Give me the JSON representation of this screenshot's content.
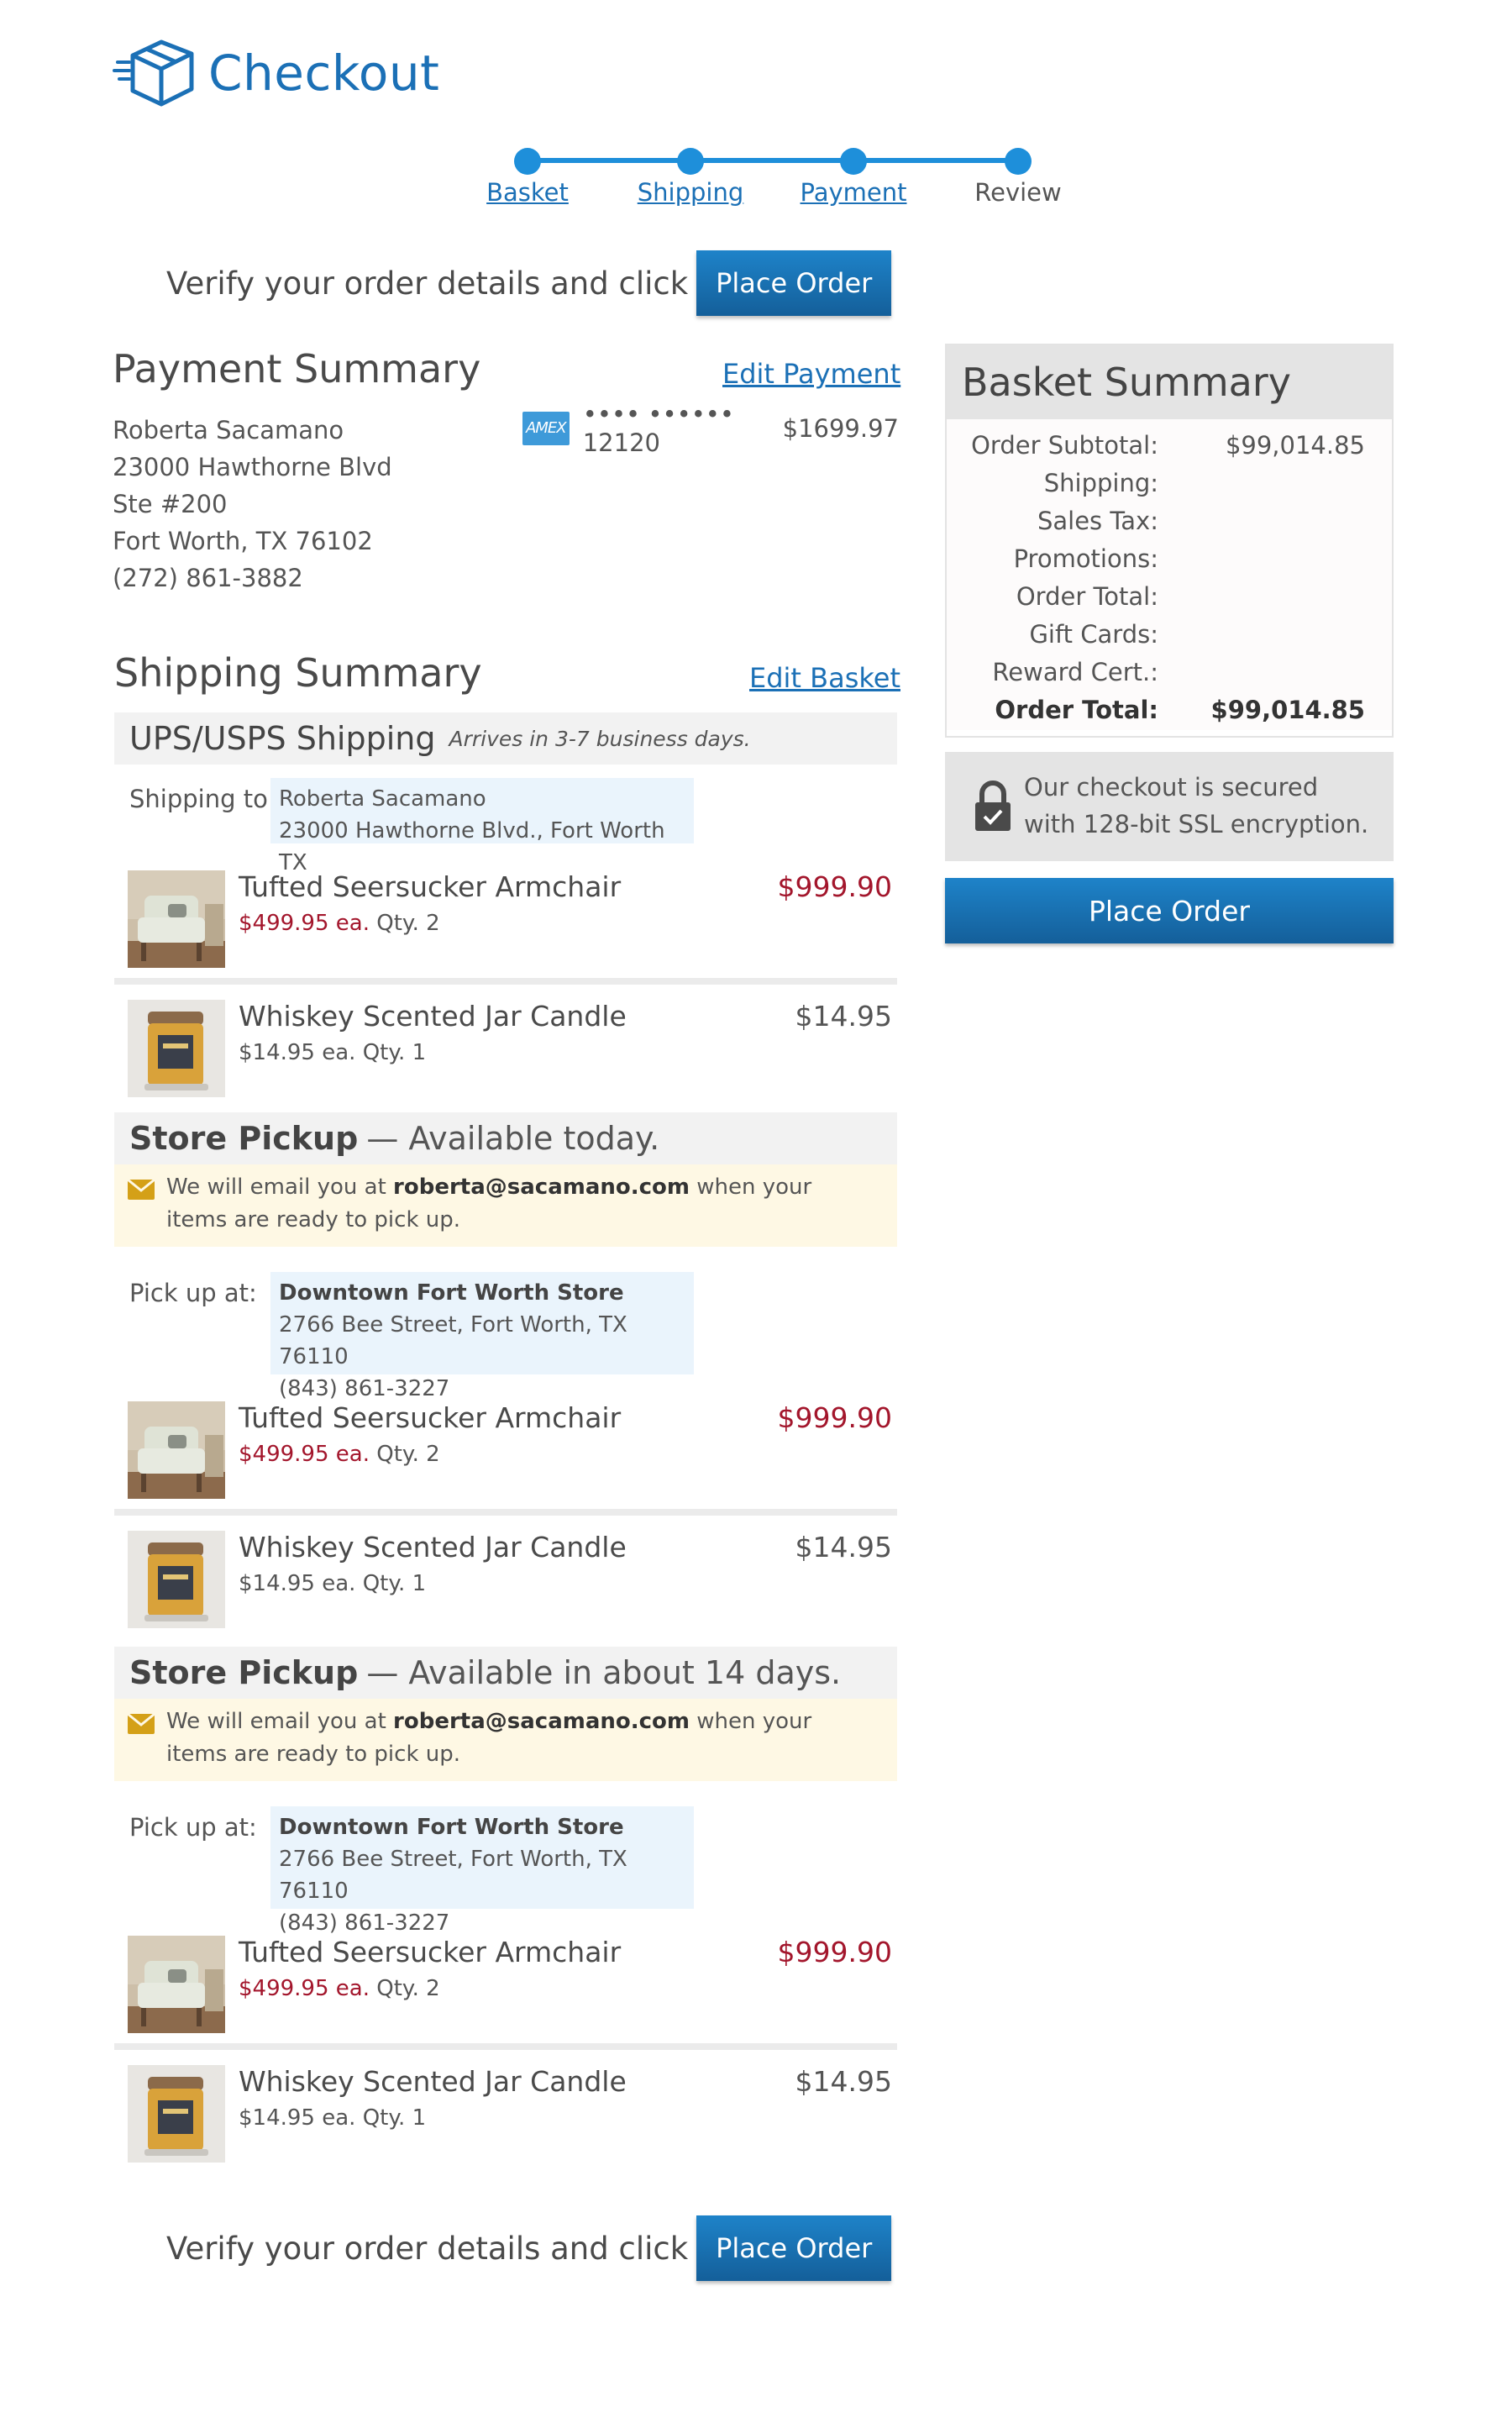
{
  "header": {
    "title": "Checkout",
    "logo_icon": "shipping-box-icon"
  },
  "steps": [
    {
      "label": "Basket",
      "state": "done"
    },
    {
      "label": "Shipping",
      "state": "done"
    },
    {
      "label": "Payment",
      "state": "done"
    },
    {
      "label": "Review",
      "state": "current"
    }
  ],
  "verify": {
    "text": "Verify your order details and click",
    "button": "Place Order"
  },
  "payment": {
    "title": "Payment Summary",
    "edit_label": "Edit Payment",
    "address": [
      "Roberta Sacamano",
      "23000 Hawthorne Blvd",
      "Ste #200",
      "Fort Worth, TX 76102",
      "(272) 861-3882"
    ],
    "card_brand": "AMEX",
    "card_masked": "•••• •••••• 12120",
    "amount": "$1699.97"
  },
  "shipping": {
    "title": "Shipping Summary",
    "edit_label": "Edit Basket",
    "method": "UPS/USPS Shipping",
    "method_note": "Arrives in 3-7 business days.",
    "ship_to_label": "Shipping to:",
    "ship_to": [
      "Roberta Sacamano",
      "23000 Hawthorne Blvd., Fort Worth TX"
    ],
    "items": [
      {
        "name": "Tufted Seersucker Armchair",
        "each": "$499.95 ea.",
        "qty": "Qty. 2",
        "total": "$999.90"
      },
      {
        "name": "Whiskey Scented Jar Candle",
        "each": "$14.95 ea.",
        "qty": "Qty. 1",
        "total": "$14.95"
      }
    ]
  },
  "pickups": [
    {
      "title": "Store Pickup",
      "availability": "— Available today.",
      "notice_pre": "We will email you at ",
      "notice_email": "roberta@sacamano.com",
      "notice_post": " when your items are ready to pick up.",
      "pickup_label": "Pick up at:",
      "store": [
        "Downtown Fort Worth Store",
        "2766 Bee Street, Fort Worth, TX 76110",
        "(843) 861-3227"
      ],
      "items": [
        {
          "name": "Tufted Seersucker Armchair",
          "each": "$499.95 ea.",
          "qty": "Qty. 2",
          "total": "$999.90"
        },
        {
          "name": "Whiskey Scented Jar Candle",
          "each": "$14.95 ea.",
          "qty": "Qty. 1",
          "total": "$14.95"
        }
      ]
    },
    {
      "title": "Store Pickup",
      "availability": "— Available in about 14 days.",
      "notice_pre": "We will email you at ",
      "notice_email": "roberta@sacamano.com",
      "notice_post": " when your items are ready to pick up.",
      "pickup_label": "Pick up at:",
      "store": [
        "Downtown Fort Worth Store",
        "2766 Bee Street, Fort Worth, TX 76110",
        "(843) 861-3227"
      ],
      "items": [
        {
          "name": "Tufted Seersucker Armchair",
          "each": "$499.95 ea.",
          "qty": "Qty. 2",
          "total": "$999.90"
        },
        {
          "name": "Whiskey Scented Jar Candle",
          "each": "$14.95 ea.",
          "qty": "Qty. 1",
          "total": "$14.95"
        }
      ]
    }
  ],
  "basket": {
    "title": "Basket Summary",
    "rows": [
      {
        "label": "Order Subtotal:",
        "value": "$99,014.85"
      },
      {
        "label": "Shipping:",
        "value": ""
      },
      {
        "label": "Sales Tax:",
        "value": ""
      },
      {
        "label": "Promotions:",
        "value": ""
      },
      {
        "label": "Order Total:",
        "value": ""
      },
      {
        "label": "Gift Cards:",
        "value": ""
      },
      {
        "label": "Reward Cert.:",
        "value": ""
      },
      {
        "label": "Order Total:",
        "value": "$99,014.85"
      }
    ]
  },
  "secure": {
    "text": "Our checkout is secured with 128-bit SSL encryption.",
    "icon": "lock-icon"
  },
  "colors": {
    "brand": "#1b70b6",
    "accent": "#1e8fda",
    "price_red": "#a3162c",
    "notice_bg": "#fef8e4",
    "address_bg": "#eaf4fc"
  }
}
